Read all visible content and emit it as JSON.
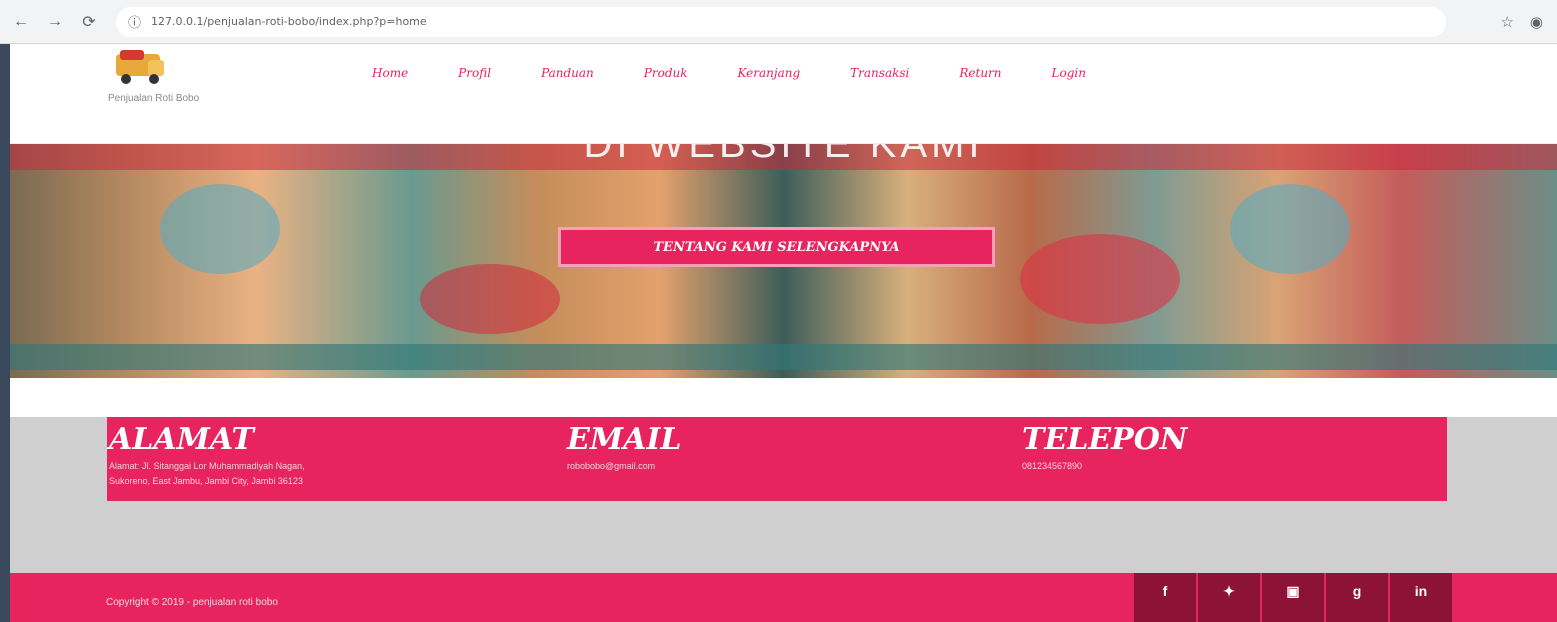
{
  "browser": {
    "url": "127.0.0.1/penjualan-roti-bobo/index.php?p=home"
  },
  "header": {
    "brand": "Penjualan Roti Bobo",
    "menu": [
      "Home",
      "Profil",
      "Panduan",
      "Produk",
      "Keranjang",
      "Transaksi",
      "Return",
      "Login"
    ]
  },
  "hero": {
    "title": "DI WEBSITE KAMI",
    "button_label": "TENTANG KAMI SELENGKAPNYA"
  },
  "contact": {
    "alamat": {
      "title": "ALAMAT",
      "line1": "Alamat: Jl. Sitanggai Lor Muhammadiyah Nagan,",
      "line2": "Sukoreno, East Jambu, Jambi City, Jambi 36123"
    },
    "email": {
      "title": "EMAIL",
      "line1": "robobobo@gmail.com"
    },
    "telepon": {
      "title": "TELEPON",
      "line1": "081234567890"
    }
  },
  "footer": {
    "copyright": "Copyright © 2019 - penjualan roti bobo",
    "socials": [
      "f",
      "t",
      "yt",
      "g+",
      "in"
    ]
  },
  "colors": {
    "accent": "#e8245e",
    "social_bg": "#8c1335"
  }
}
